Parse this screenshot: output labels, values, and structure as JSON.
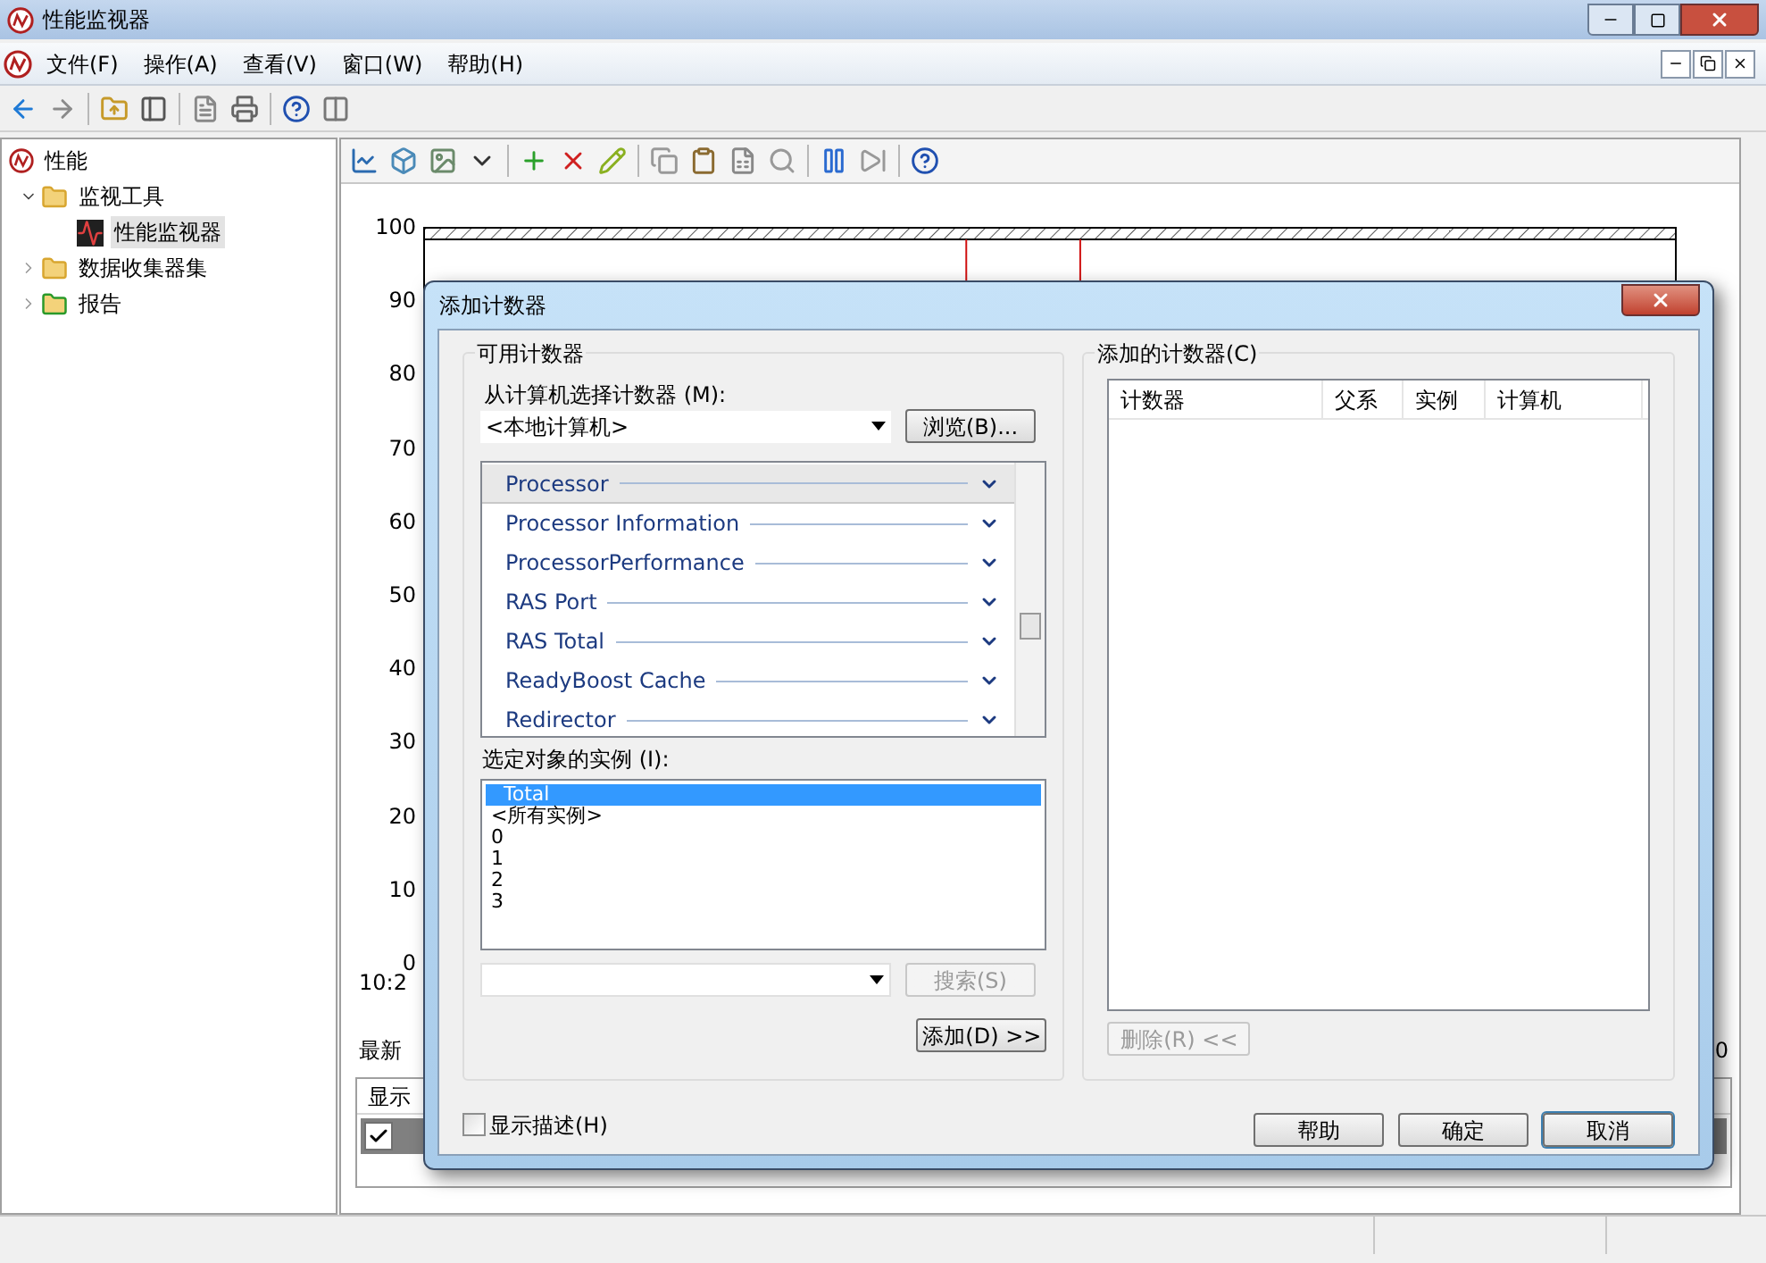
{
  "window": {
    "title": "性能监视器"
  },
  "menu": [
    "文件(F)",
    "操作(A)",
    "查看(V)",
    "窗口(W)",
    "帮助(H)"
  ],
  "tree": [
    {
      "label": "性能",
      "kind": "root",
      "selected": false,
      "children": [
        {
          "label": "监视工具",
          "kind": "folder",
          "expanded": true,
          "selected": false,
          "children": [
            {
              "label": "性能监视器",
              "kind": "monitor",
              "selected": true
            }
          ]
        },
        {
          "label": "数据收集器集",
          "kind": "folder",
          "expanded": false,
          "selected": false
        },
        {
          "label": "报告",
          "kind": "report",
          "expanded": false,
          "selected": false
        }
      ]
    }
  ],
  "chart": {
    "y_ticks": [
      "100",
      "90",
      "80",
      "70",
      "60",
      "50",
      "40",
      "30",
      "20",
      "10",
      "0"
    ],
    "x_label": "10:2",
    "latest_label": "最新",
    "latest_value": "0"
  },
  "legend": {
    "columns": [
      "显示"
    ],
    "rows": [
      {
        "checked": true
      }
    ]
  },
  "dialog": {
    "title": "添加计数器",
    "available": {
      "title": "可用计数器",
      "computer_label": "从计算机选择计数器 (M):",
      "computer": "<本地计算机>",
      "browse_button": "浏览(B)...",
      "counters": [
        {
          "name": "Processor",
          "selected": true
        },
        {
          "name": "Processor Information",
          "selected": false
        },
        {
          "name": "ProcessorPerformance",
          "selected": false
        },
        {
          "name": "RAS Port",
          "selected": false
        },
        {
          "name": "RAS Total",
          "selected": false
        },
        {
          "name": "ReadyBoost Cache",
          "selected": false
        },
        {
          "name": "Redirector",
          "selected": false
        }
      ],
      "instances_label": "选定对象的实例 (I):",
      "instances": [
        {
          "name": "Total",
          "selected": true
        },
        {
          "name": "<所有实例>",
          "selected": false
        },
        {
          "name": "0",
          "selected": false
        },
        {
          "name": "1",
          "selected": false
        },
        {
          "name": "2",
          "selected": false
        },
        {
          "name": "3",
          "selected": false
        }
      ],
      "search_button": {
        "label": "搜索(S)",
        "disabled": true
      },
      "add_button": "添加(D) >>"
    },
    "added": {
      "title": "添加的计数器(C)",
      "columns": [
        "计数器",
        "父系",
        "实例",
        "计算机"
      ],
      "remove_button": {
        "label": "删除(R) <<",
        "disabled": true
      }
    },
    "show_description": {
      "label": "显示描述(H)",
      "checked": false
    },
    "buttons": [
      {
        "label": "帮助",
        "default": false
      },
      {
        "label": "确定",
        "default": false
      },
      {
        "label": "取消",
        "default": true
      }
    ]
  }
}
